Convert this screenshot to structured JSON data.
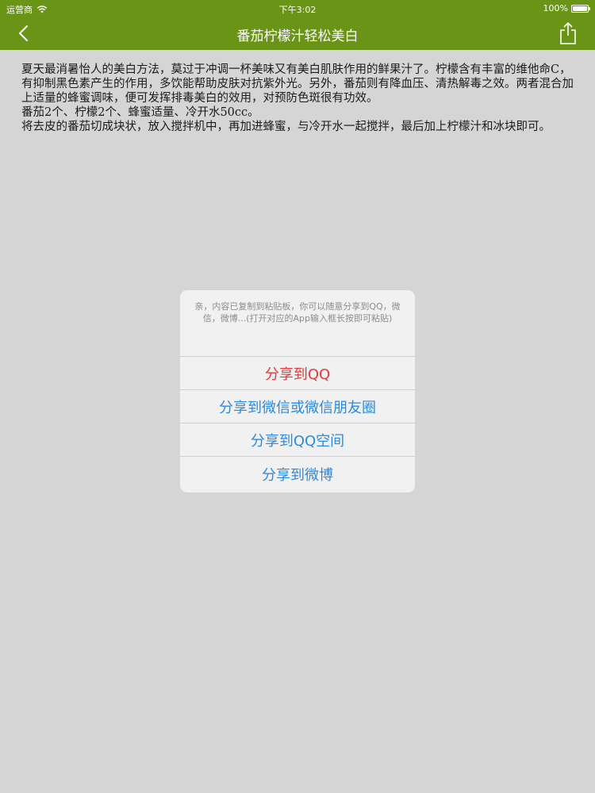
{
  "status_bar": {
    "carrier": "运营商",
    "time": "下午3:02",
    "battery": "100%"
  },
  "nav": {
    "title": "番茄柠檬汁轻松美白",
    "back_icon": "chevron-left-icon",
    "share_icon": "share-icon"
  },
  "article": {
    "paragraphs": [
      "夏天最消暑怡人的美白方法，莫过于冲调一杯美味又有美白肌肤作用的鲜果汁了。柠檬含有丰富的维他命C，有抑制黑色素产生的作用，多饮能帮助皮肤对抗紫外光。另外，番茄则有降血压、清热解毒之效。两者混合加上适量的蜂蜜调味，便可发挥排毒美白的效用，对预防色斑很有功效。",
      "番茄2个、柠檬2个、蜂蜜适量、冷开水50cc。",
      "将去皮的番茄切成块状，放入搅拌机中，再加进蜂蜜，与冷开水一起搅拌，最后加上柠檬汁和冰块即可。"
    ]
  },
  "alert": {
    "message": "亲，内容已复制到粘贴板，你可以随意分享到QQ，微信，微博...(打开对应的App输入框长按即可粘贴)",
    "options": [
      "分享到QQ",
      "分享到微信或微信朋友圈",
      "分享到QQ空间",
      "分享到微博"
    ]
  },
  "colors": {
    "nav_background": "#6a9416",
    "page_background": "#d5d5d5",
    "alert_action": "#2a8ae0",
    "alert_destructive": "#e23a3a"
  }
}
